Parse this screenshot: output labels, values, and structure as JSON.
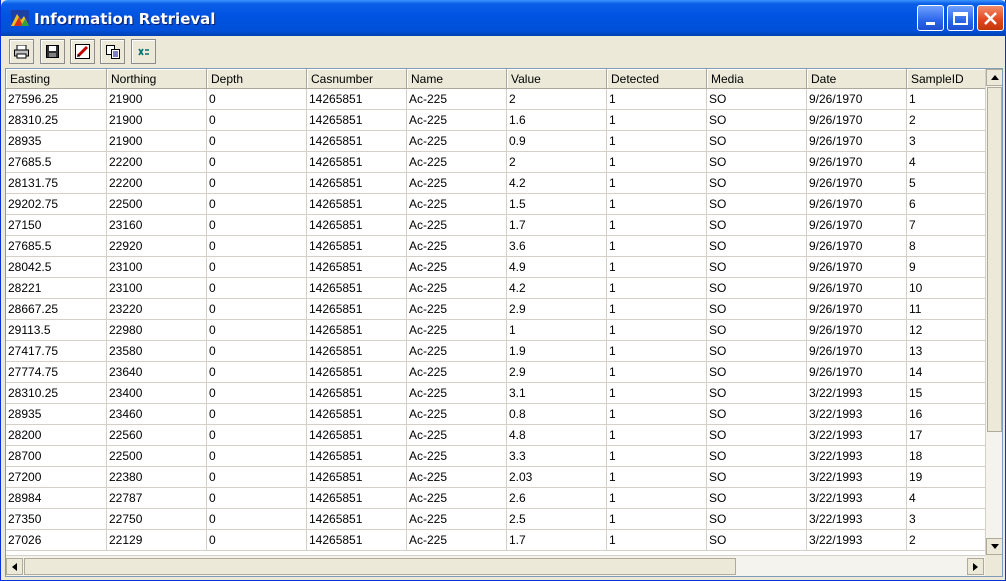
{
  "window": {
    "title": "Information Retrieval",
    "icons": {
      "app": "app-mountain-icon",
      "minimize": "minimize-icon",
      "maximize": "maximize-icon",
      "close": "close-icon"
    }
  },
  "toolbar": {
    "tools": [
      {
        "name": "print-tool",
        "icon": "printer-icon"
      },
      {
        "name": "save-tool",
        "icon": "floppy-disk-icon"
      },
      {
        "name": "edit-tool",
        "icon": "pencil-icon"
      },
      {
        "name": "copy-tool",
        "icon": "copy-icon"
      },
      {
        "name": "export-tool",
        "icon": "excel-icon"
      }
    ]
  },
  "table": {
    "columns": [
      "Easting",
      "Northing",
      "Depth",
      "Casnumber",
      "Name",
      "Value",
      "Detected",
      "Media",
      "Date",
      "SampleID"
    ],
    "rows": [
      [
        "27596.25",
        "21900",
        "0",
        "14265851",
        "Ac-225",
        "2",
        "1",
        "SO",
        "9/26/1970",
        "1"
      ],
      [
        "28310.25",
        "21900",
        "0",
        "14265851",
        "Ac-225",
        "1.6",
        "1",
        "SO",
        "9/26/1970",
        "2"
      ],
      [
        "28935",
        "21900",
        "0",
        "14265851",
        "Ac-225",
        "0.9",
        "1",
        "SO",
        "9/26/1970",
        "3"
      ],
      [
        "27685.5",
        "22200",
        "0",
        "14265851",
        "Ac-225",
        "2",
        "1",
        "SO",
        "9/26/1970",
        "4"
      ],
      [
        "28131.75",
        "22200",
        "0",
        "14265851",
        "Ac-225",
        "4.2",
        "1",
        "SO",
        "9/26/1970",
        "5"
      ],
      [
        "29202.75",
        "22500",
        "0",
        "14265851",
        "Ac-225",
        "1.5",
        "1",
        "SO",
        "9/26/1970",
        "6"
      ],
      [
        "27150",
        "23160",
        "0",
        "14265851",
        "Ac-225",
        "1.7",
        "1",
        "SO",
        "9/26/1970",
        "7"
      ],
      [
        "27685.5",
        "22920",
        "0",
        "14265851",
        "Ac-225",
        "3.6",
        "1",
        "SO",
        "9/26/1970",
        "8"
      ],
      [
        "28042.5",
        "23100",
        "0",
        "14265851",
        "Ac-225",
        "4.9",
        "1",
        "SO",
        "9/26/1970",
        "9"
      ],
      [
        "28221",
        "23100",
        "0",
        "14265851",
        "Ac-225",
        "4.2",
        "1",
        "SO",
        "9/26/1970",
        "10"
      ],
      [
        "28667.25",
        "23220",
        "0",
        "14265851",
        "Ac-225",
        "2.9",
        "1",
        "SO",
        "9/26/1970",
        "11"
      ],
      [
        "29113.5",
        "22980",
        "0",
        "14265851",
        "Ac-225",
        "1",
        "1",
        "SO",
        "9/26/1970",
        "12"
      ],
      [
        "27417.75",
        "23580",
        "0",
        "14265851",
        "Ac-225",
        "1.9",
        "1",
        "SO",
        "9/26/1970",
        "13"
      ],
      [
        "27774.75",
        "23640",
        "0",
        "14265851",
        "Ac-225",
        "2.9",
        "1",
        "SO",
        "9/26/1970",
        "14"
      ],
      [
        "28310.25",
        "23400",
        "0",
        "14265851",
        "Ac-225",
        "3.1",
        "1",
        "SO",
        "3/22/1993",
        "15"
      ],
      [
        "28935",
        "23460",
        "0",
        "14265851",
        "Ac-225",
        "0.8",
        "1",
        "SO",
        "3/22/1993",
        "16"
      ],
      [
        "28200",
        "22560",
        "0",
        "14265851",
        "Ac-225",
        "4.8",
        "1",
        "SO",
        "3/22/1993",
        "17"
      ],
      [
        "28700",
        "22500",
        "0",
        "14265851",
        "Ac-225",
        "3.3",
        "1",
        "SO",
        "3/22/1993",
        "18"
      ],
      [
        "27200",
        "22380",
        "0",
        "14265851",
        "Ac-225",
        "2.03",
        "1",
        "SO",
        "3/22/1993",
        "19"
      ],
      [
        "28984",
        "22787",
        "0",
        "14265851",
        "Ac-225",
        "2.6",
        "1",
        "SO",
        "3/22/1993",
        "4"
      ],
      [
        "27350",
        "22750",
        "0",
        "14265851",
        "Ac-225",
        "2.5",
        "1",
        "SO",
        "3/22/1993",
        "3"
      ],
      [
        "27026",
        "22129",
        "0",
        "14265851",
        "Ac-225",
        "1.7",
        "1",
        "SO",
        "3/22/1993",
        "2"
      ]
    ]
  },
  "colors": {
    "titlebar": "#0053e1",
    "close_button": "#e0461c",
    "window_face": "#ece9d8"
  }
}
